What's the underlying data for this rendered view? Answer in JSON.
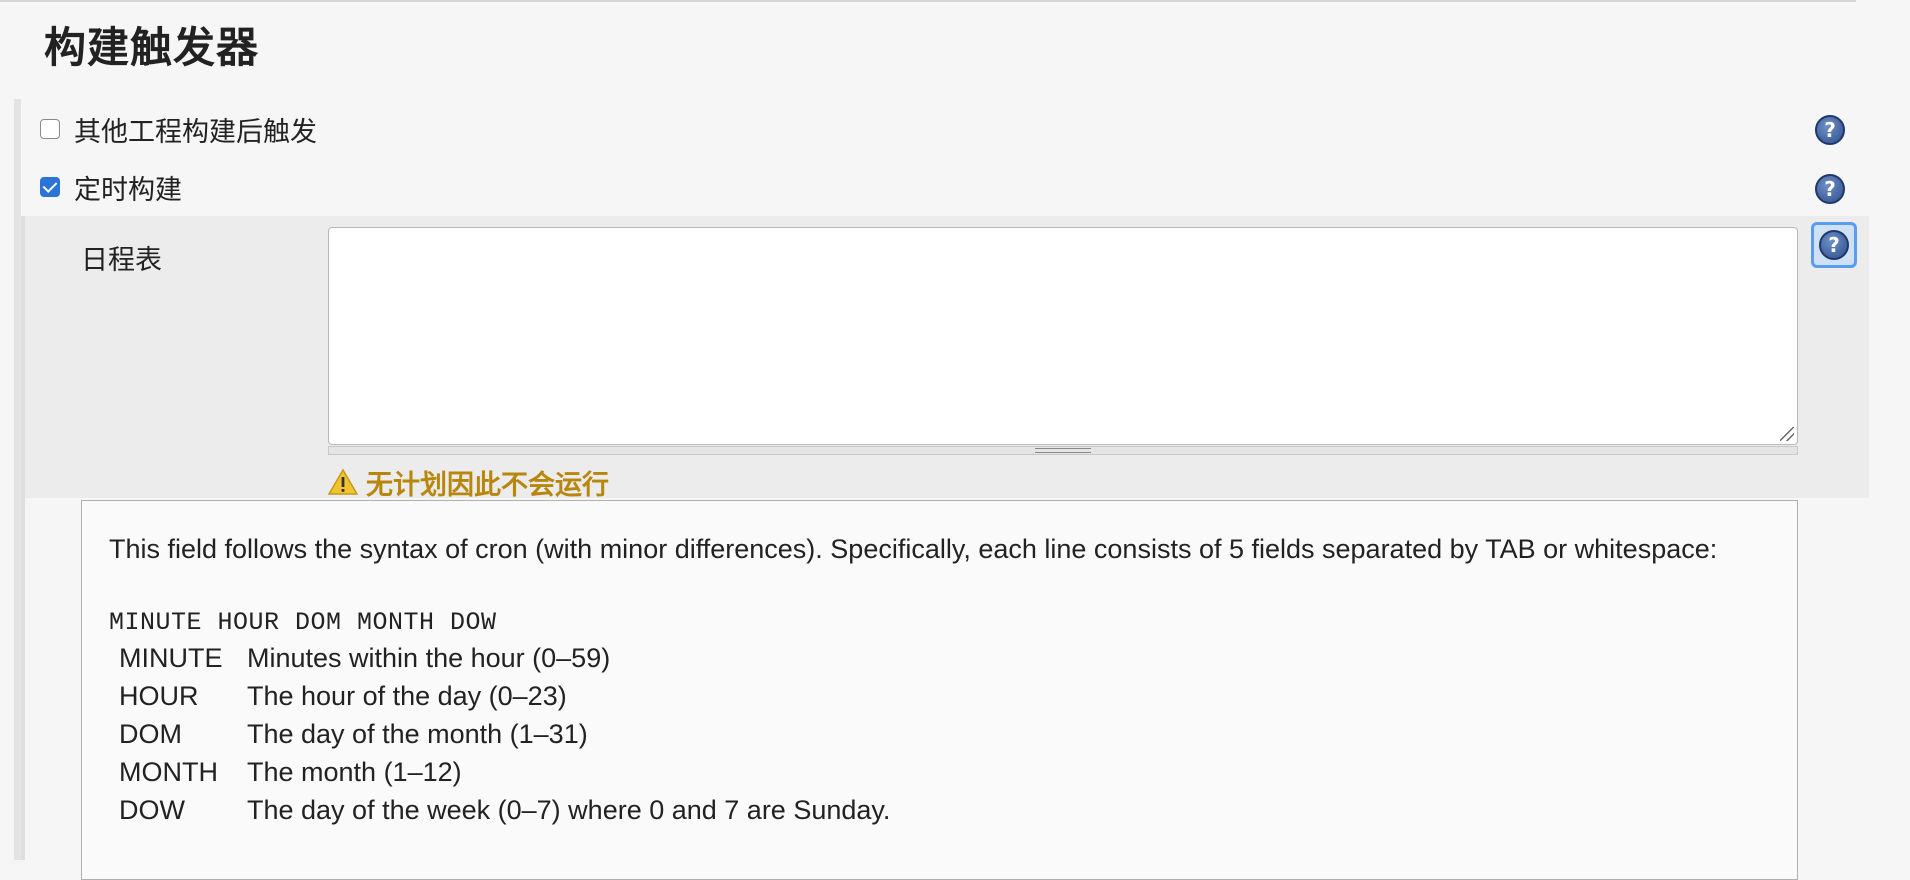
{
  "section": {
    "title": "构建触发器"
  },
  "triggers": [
    {
      "label": "其他工程构建后触发",
      "checked": false
    },
    {
      "label": "定时构建",
      "checked": true
    }
  ],
  "schedule": {
    "label": "日程表",
    "value": "",
    "warning": "无计划因此不会运行"
  },
  "help": {
    "icon_glyph": "?",
    "intro": "This field follows the syntax of cron (with minor differences). Specifically, each line consists of 5 fields separated by TAB or whitespace:",
    "syntax": "MINUTE HOUR DOM MONTH DOW",
    "fields": [
      {
        "name": "MINUTE",
        "desc": "Minutes within the hour (0–59)"
      },
      {
        "name": "HOUR",
        "desc": "The hour of the day (0–23)"
      },
      {
        "name": "DOM",
        "desc": "The day of the month (1–31)"
      },
      {
        "name": "MONTH",
        "desc": "The month (1–12)"
      },
      {
        "name": "DOW",
        "desc": "The day of the week (0–7) where 0 and 7 are Sunday."
      }
    ]
  },
  "colors": {
    "checkbox_checked": "#2a73d9",
    "warning_text": "#b8860b",
    "help_icon": "#2f4f8c"
  }
}
